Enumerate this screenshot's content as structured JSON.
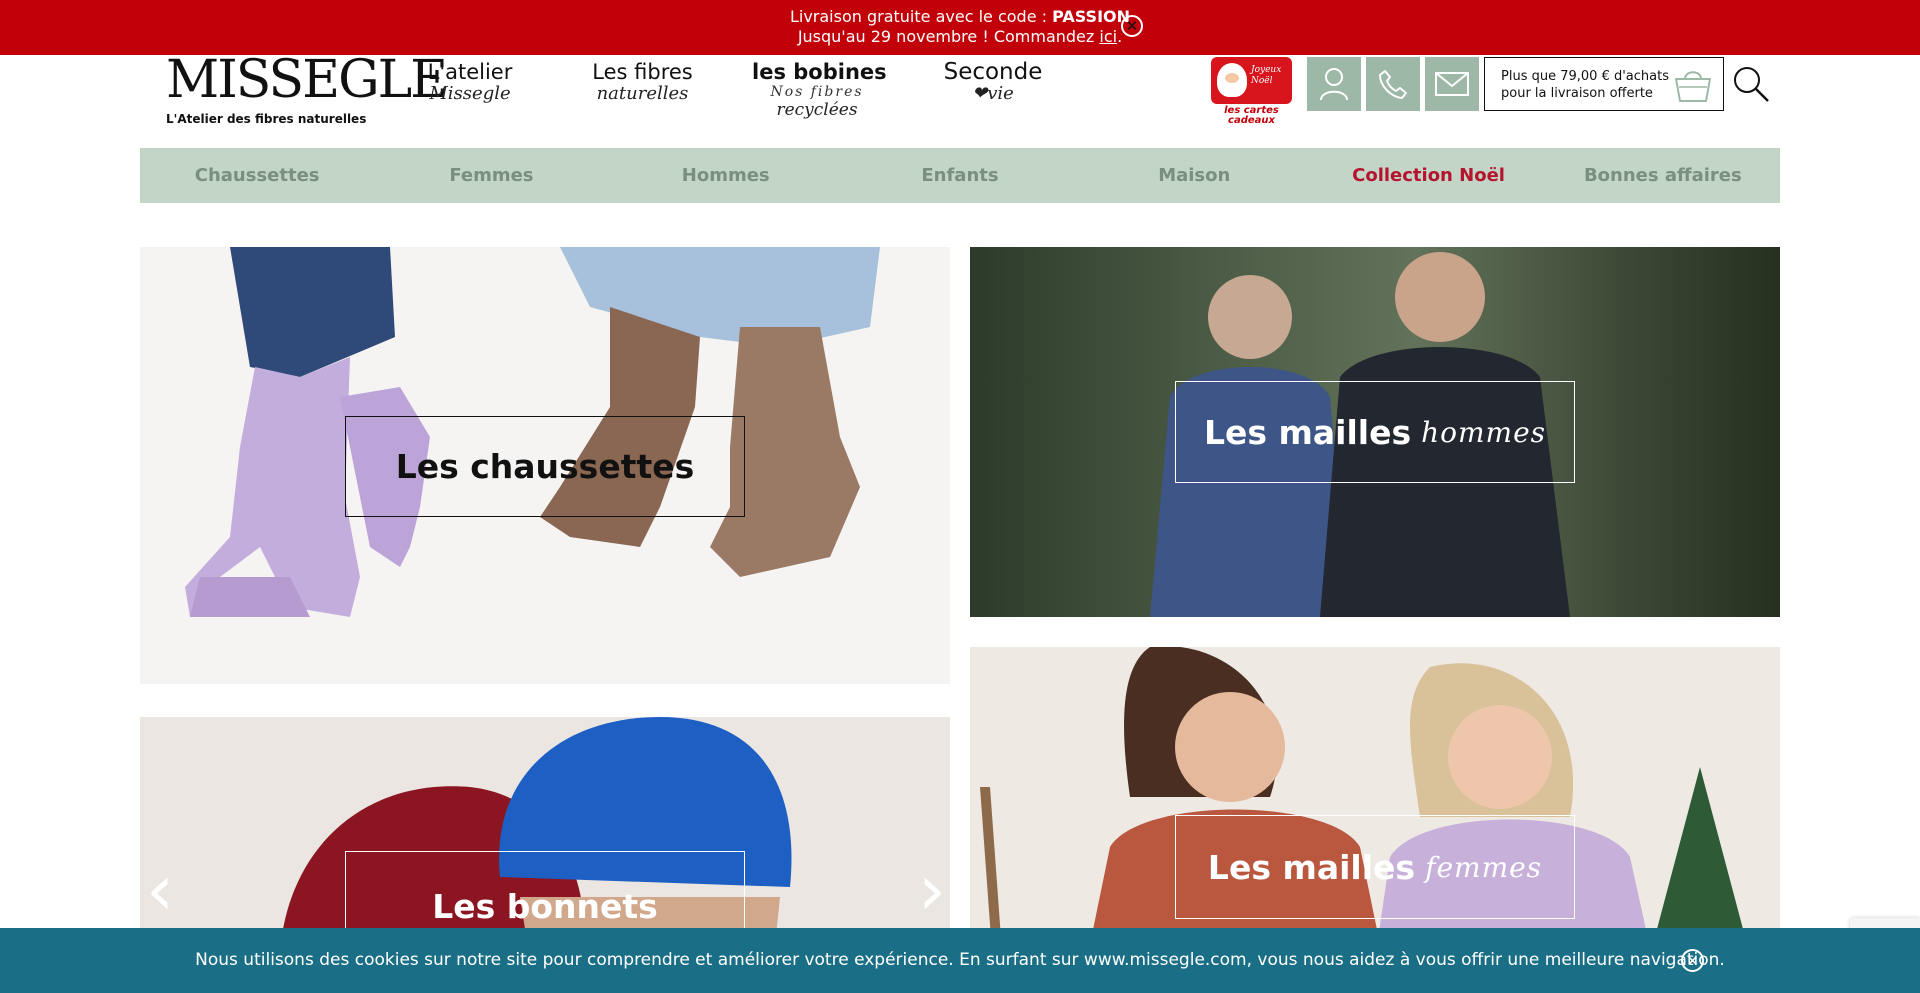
{
  "promo": {
    "line1_text": "Livraison gratuite avec le code : ",
    "line1_code": "PASSION",
    "line2_text": "Jusqu'au 29 novembre ! Commandez ",
    "line2_link": "ici",
    "line2_end": ".",
    "close_icon": "✕"
  },
  "logo": {
    "word": "MISSEGLE",
    "tagline": "L'Atelier des fibres naturelles"
  },
  "brand_links": [
    {
      "line1": "L'atelier",
      "line2": "Missegle"
    },
    {
      "line1": "Les fibres",
      "line2": "naturelles"
    },
    {
      "line1": "les bobines",
      "line2": "Nos fibres",
      "line3": "recyclées"
    },
    {
      "line1": "Seconde",
      "line2": "❤vie"
    }
  ],
  "gift_card": {
    "card_text": "Joyeux Noël",
    "label_line1": "les cartes",
    "label_line2": "cadeaux"
  },
  "icons": {
    "account": "user-icon",
    "phone": "phone-icon",
    "mail": "mail-icon",
    "cart": "shopping-bag-icon",
    "search": "search-icon",
    "accent_color": "#9db8a6"
  },
  "cart": {
    "line1": "Plus que 79,00 € d'achats",
    "line2": "pour la livraison offerte"
  },
  "category_nav": [
    {
      "label": "Chaussettes"
    },
    {
      "label": "Femmes"
    },
    {
      "label": "Hommes"
    },
    {
      "label": "Enfants"
    },
    {
      "label": "Maison"
    },
    {
      "label": "Collection Noël"
    },
    {
      "label": "Bonnes affaires"
    }
  ],
  "tiles": {
    "socks": {
      "title": "Les chaussettes"
    },
    "men": {
      "title": "Les mailles",
      "script": "hommes"
    },
    "hats": {
      "title": "Les bonnets"
    },
    "women": {
      "title": "Les mailles",
      "script": "femmes"
    }
  },
  "carousel": {
    "prev": "‹",
    "next": "›"
  },
  "cookie": {
    "text": "Nous utilisons des cookies sur notre site pour comprendre et améliorer votre expérience. En surfant sur www.missegle.com, vous nous aidez à vous offrir une meilleure navigation.",
    "close_icon": "✕"
  },
  "colors": {
    "promo_bg": "#c20009",
    "nav_bg": "#c2d5c7",
    "nav_text": "#7a8f80",
    "nav_highlight": "#b5142e",
    "cookie_bg": "#1a6f86"
  }
}
